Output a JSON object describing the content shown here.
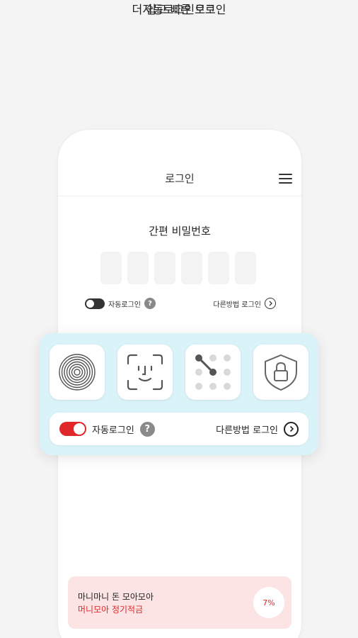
{
  "headline": {
    "line1": "자동로그인으로",
    "line2": "더 쉽고 빠른 로그인"
  },
  "header": {
    "title": "로그인",
    "menu_icon": "hamburger-menu-icon"
  },
  "pin": {
    "title": "간편 비밀번호",
    "digits": 6
  },
  "mini_options": {
    "auto_login_label": "자동로그인",
    "help_symbol": "?",
    "other_method_label": "다른방법 로그인",
    "chevron_symbol": "›"
  },
  "methods": [
    {
      "name": "fingerprint",
      "icon": "fingerprint-icon"
    },
    {
      "name": "face-id",
      "icon": "face-id-icon"
    },
    {
      "name": "pattern",
      "icon": "pattern-icon"
    },
    {
      "name": "certificate",
      "icon": "shield-lock-icon"
    }
  ],
  "options": {
    "auto_login_label": "자동로그인",
    "auto_login_enabled": true,
    "help_symbol": "?",
    "other_method_label": "다른방법 로그인"
  },
  "promo": {
    "line1": "마니마니 돈 모아모아",
    "line2": "머니모아 정기적금",
    "badge": "7%"
  },
  "colors": {
    "accent": "#e0282a",
    "panel_bg": "#d9f3f8",
    "promo_bg": "#fde4e4",
    "page_bg": "#f4f4f4"
  }
}
